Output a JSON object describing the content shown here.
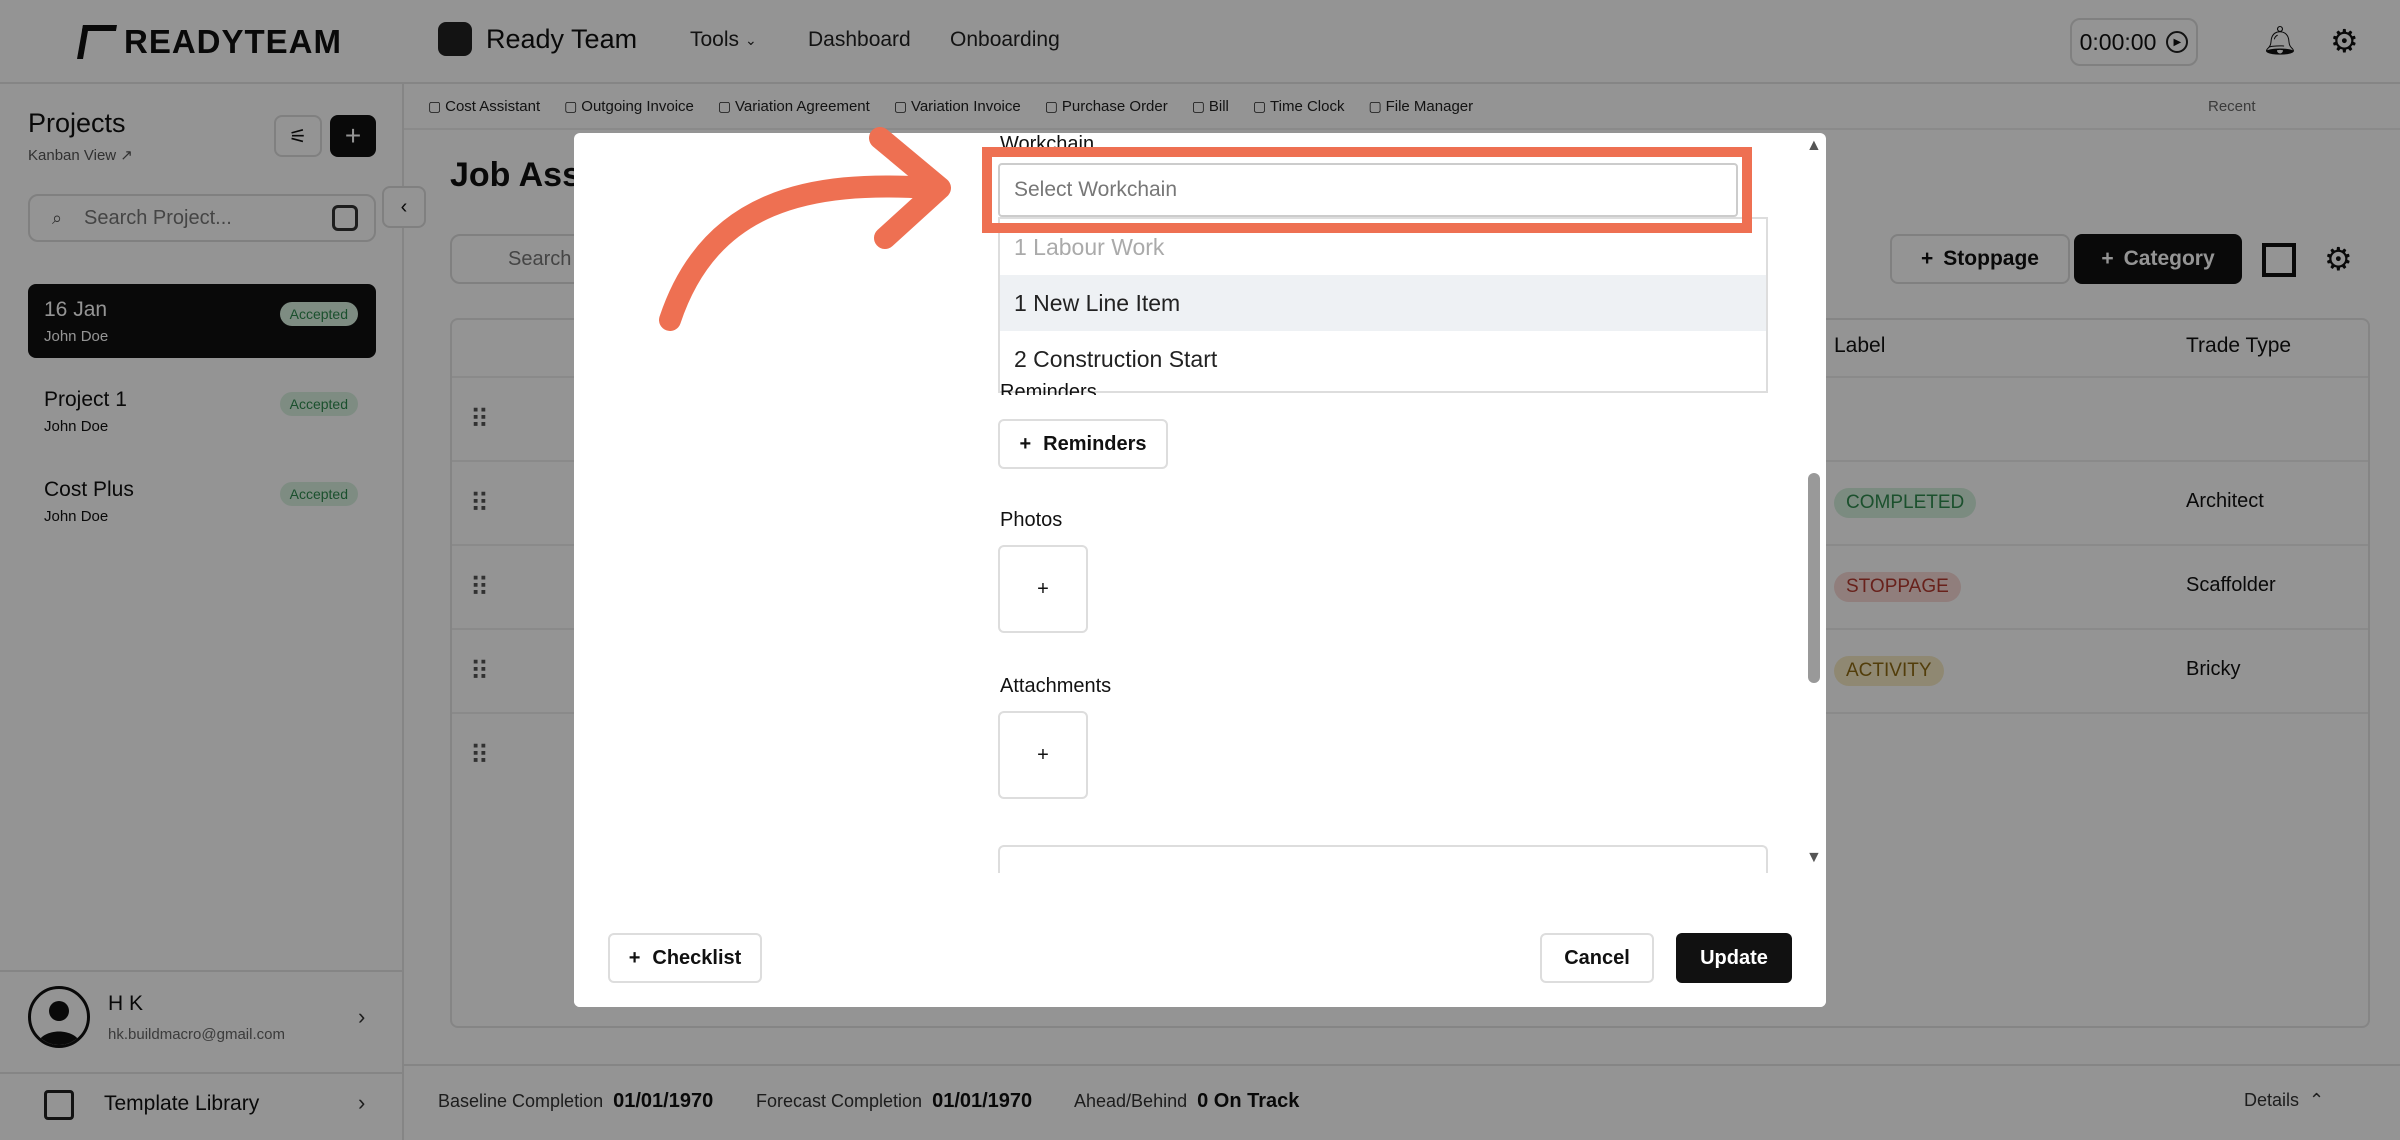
{
  "app": {
    "brand": "READYTEAM",
    "workspace": "Ready Team"
  },
  "nav": {
    "tools": "Tools",
    "dashboard": "Dashboard",
    "onboarding": "Onboarding",
    "timer": "0:00:00"
  },
  "sidebar": {
    "title": "Projects",
    "view": "Kanban View",
    "search_placeholder": "Search Project...",
    "projects": [
      {
        "name": "16 Jan",
        "owner": "John Doe",
        "status": "Accepted"
      },
      {
        "name": "Project 1",
        "owner": "John Doe",
        "status": "Accepted"
      },
      {
        "name": "Cost Plus",
        "owner": "John Doe",
        "status": "Accepted"
      }
    ],
    "user": {
      "name": "H K",
      "email": "hk.buildmacro@gmail.com"
    },
    "template_library": "Template Library"
  },
  "toolbar": {
    "items": [
      "Cost Assistant",
      "Outgoing Invoice",
      "Variation Agreement",
      "Variation Invoice",
      "Purchase Order",
      "Bill",
      "Time Clock",
      "File Manager"
    ],
    "recent": "Recent"
  },
  "main": {
    "title": "Job Ass",
    "search": "Search",
    "stoppage_btn": "Stoppage",
    "category_btn": "Category",
    "col_label": "Label",
    "col_trade": "Trade Type",
    "rows": [
      {
        "label": "",
        "trade": ""
      },
      {
        "label": "COMPLETED",
        "trade": "Architect"
      },
      {
        "label": "STOPPAGE",
        "trade": "Scaffolder"
      },
      {
        "label": "ACTIVITY",
        "trade": "Bricky"
      },
      {
        "label": "",
        "trade": ""
      }
    ],
    "label_colors": {
      "COMPLETED": "#d4f0dc",
      "STOPPAGE": "#f8d9d6",
      "ACTIVITY": "#f7ebc5"
    }
  },
  "footer": {
    "baseline_label": "Baseline Completion",
    "baseline_value": "01/01/1970",
    "forecast_label": "Forecast Completion",
    "forecast_value": "01/01/1970",
    "ahead_label": "Ahead/Behind",
    "ahead_value": "0 On Track",
    "details": "Details"
  },
  "modal": {
    "workchain_label": "Workchain",
    "workchain_placeholder": "Select Workchain",
    "options": [
      "1 Labour Work",
      "1 New Line Item",
      "2 Construction Start"
    ],
    "reminders_label": "Reminders",
    "reminders_btn": "Reminders",
    "photos_label": "Photos",
    "attachments_label": "Attachments",
    "checklist_btn": "Checklist",
    "cancel_btn": "Cancel",
    "update_btn": "Update"
  },
  "colors": {
    "accent": "#ee7052",
    "dark": "#111111"
  }
}
